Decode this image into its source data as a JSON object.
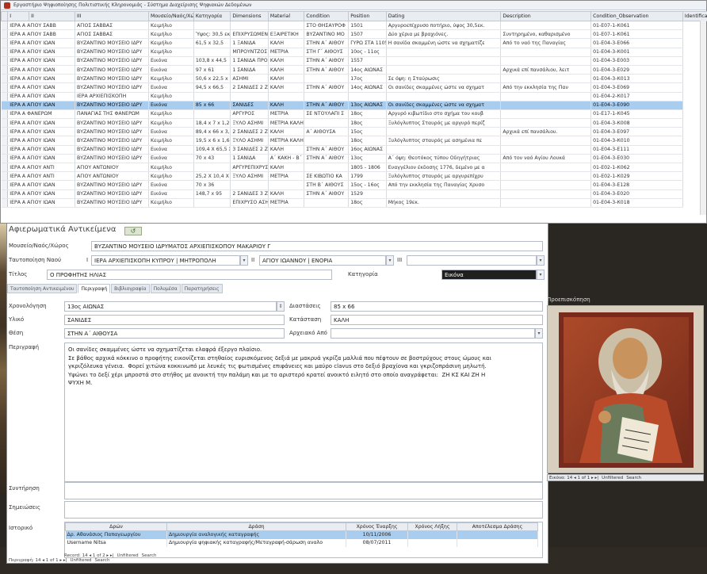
{
  "window": {
    "title": "Εργαστήριο Ψηφιοποίησης Πολιτιστικής Κληρονομιάς - Σύστημα Διαχείρισης Ψηφιακών Δεδομένων"
  },
  "grid": {
    "columns": [
      "Ι",
      "ΙΙ",
      "ΙΙΙ",
      "Μουσείο/Ναός/Χώρος",
      "Κατηγορία",
      "Dimensions",
      "Material",
      "Condition",
      "Position",
      "Dating",
      "Description",
      "Condition_Observation",
      "Identification_Number"
    ],
    "rows": [
      [
        "ΙΕΡΑ Α ΑΓΙΟΥ ΣΑΒΒ",
        "ΑΓΙΟΣ ΣΑΒΒΑΣ",
        "Κειμήλιο",
        "",
        "",
        "",
        "ΣΤΟ ΘΗΣΑΥΡΟΦ",
        "1501",
        "Αργυροεπίχρυσο ποτήριο, ύψος 30,5εκ.",
        "",
        "01-Ε07-1-К061"
      ],
      [
        "ΙΕΡΑ Α ΑΓΙΟΥ ΣΑΒΒ",
        "ΑΓΙΟΣ ΣΑΒΒΑΣ",
        "Κειμήλιο",
        "Ύψος: 30,5 εκ.,",
        "ΕΠΙΧΡΥΣΩΜΕΝ",
        "ΕΞΑΙΡΕΤΙΚΗ",
        "ΒΥΖΑΝΤΙΝΟ ΜΟ",
        "1507",
        "Δύο χέρια με βραχιόνες.",
        "Συντηρημένο, καθαρισμένο",
        "01-Ε07-1-К061"
      ],
      [
        "ΙΕΡΑ Α ΑΓΙΟΥ ΙΩΑΝ",
        "ΒΥΖΑΝΤΙΝΟ ΜΟΥΣΕΙΟ ΙΔΡΥ",
        "Κειμήλιο",
        "61,5 x 32,5",
        "1 ΞΑΝΙΔΑ",
        "ΚΑΛΗ",
        "ΣΤΗΝ Α΄ ΑΙΘΟΥ",
        "ΓΥΡΩ ΣΤΑ 1105",
        "Η σανίδα σκαμμένη ώστε να σχηματίζε",
        "Από το ναό της Παναγίας",
        "01-Ε04-3-Е066"
      ],
      [
        "ΙΕΡΑ Α ΑΓΙΟΥ ΙΩΑΝ",
        "ΒΥΖΑΝΤΙΝΟ ΜΟΥΣΕΙΟ ΙΔΡΥ",
        "Κειμήλιο",
        "",
        "ΜΠΡΟΥΝΤΖΟΣ",
        "ΜΕΤΡΙΑ",
        "ΣΤΗ Γ΄ ΑΙΘΟΥΣ",
        "10ος - 11ος",
        "",
        "",
        "01-Ε04-3-К001"
      ],
      [
        "ΙΕΡΑ Α ΑΓΙΟΥ ΙΩΑΝ",
        "ΒΥΖΑΝΤΙΝΟ ΜΟΥΣΕΙΟ ΙΔΡΥ",
        "Εικόνα",
        "103,8 x 44,5",
        "1 ΣΑΝΙΔΑ ΠΡΟΣ",
        "ΚΑΛΗ",
        "ΣΤΗΝ Α΄ ΑΙΘΟΥ",
        "1557",
        "",
        "",
        "01-Ε04-3-Е003"
      ],
      [
        "ΙΕΡΑ Α ΑΓΙΟΥ ΙΩΑΝ",
        "ΒΥΖΑΝΤΙΝΟ ΜΟΥΣΕΙΟ ΙΔΡΥ",
        "Εικόνα",
        "97 x 61",
        "1 ΣΑΝΙΔΑ",
        "ΚΑΛΗ",
        "ΣΤΗΝ Α΄ ΑΙΘΟΥ",
        "14ος ΑΙΩΝΑΣ",
        "",
        "Αρχικά επί πανσάλιου, λειτ",
        "01-Ε04-3-Е029"
      ],
      [
        "ΙΕΡΑ Α ΑΓΙΟΥ ΙΩΑΝ",
        "ΒΥΖΑΝΤΙΝΟ ΜΟΥΣΕΙΟ ΙΔΡΥ",
        "Κειμήλιο",
        "50,6 x 22,5 x 2,",
        "ΑΣΗΜΙ",
        "ΚΑΛΗ",
        "",
        "17ος",
        "Σε όψη: η Σταύρωσις",
        "",
        "01-Ε04-3-К013"
      ],
      [
        "ΙΕΡΑ Α ΑΓΙΟΥ ΙΩΑΝ",
        "ΒΥΖΑΝΤΙΝΟ ΜΟΥΣΕΙΟ ΙΔΡΥ",
        "Εικόνα",
        "94,5 x 66,5",
        "2 ΣΑΝΙΔΕΣ 2 ΖΥΓ",
        "ΚΑΛΗ",
        "ΣΤΗΝ Α΄ ΑΙΘΟΥ",
        "14ος ΑΙΩΝΑΣ",
        "Οι σανίδες σκαμμένες ώστε να σχηματ",
        "Από την εκκλησία της Παν",
        "01-Ε04-3-Е069"
      ],
      [
        "ΙΕΡΑ Α ΑΓΙΟΥ ΙΩΑΝ",
        "ΙΕΡΑ ΑΡΧΙΕΠΙΣΚΟΠΗ",
        "Κειμήλιο",
        "",
        "",
        "",
        "",
        "",
        "",
        "",
        "01-Ε04-2-К017"
      ],
      [
        "ΙΕΡΑ Α ΑΓΙΟΥ ΙΩΑΝ",
        "ΒΥΖΑΝΤΙΝΟ ΜΟΥΣΕΙΟ ΙΔΡΥ",
        "Εικόνα",
        "85 x 66",
        "ΣΑΝΙΔΕΣ",
        "ΚΑΛΗ",
        "ΣΤΗΝ Α΄ ΑΙΘΟΥ",
        "13ος ΑΙΩΝΑΣ",
        "Οι σανίδες σκαμμένες ώστε να σχηματ",
        "",
        "01-Ε04-3-Е090"
      ],
      [
        "ΙΕΡΑ Α ΦΑΝΕΡΩΜ",
        "ΠΑΝΑΓΙΑΣ ΤΗΣ ΦΑΝΕΡΩΜ",
        "Κειμήλιο",
        "",
        "ΑΡΓΥΡΟΣ",
        "ΜΕΤΡΙΑ",
        "ΣΕ ΝΤΟΥΛΑΠΙ Σ",
        "18ος",
        "Αργυρό κιβωτίδιο στο σχήμα του κουβ",
        "",
        "01-Ε17-1-К045"
      ],
      [
        "ΙΕΡΑ Α ΑΓΙΟΥ ΙΩΑΝ",
        "ΒΥΖΑΝΤΙΝΟ ΜΟΥΣΕΙΟ ΙΔΡΥ",
        "Κειμήλιο",
        "18,4 x 7 x 1,2",
        "ΞΥΛΟ ΑΣΗΜΙ",
        "ΜΕΤΡΙΑ ΚΑΛΗ",
        "",
        "18ος",
        "Ξυλόγλυπτος Σταυρός με αργυρό περίζ",
        "",
        "01-Ε04-3-К008"
      ],
      [
        "ΙΕΡΑ Α ΑΓΙΟΥ ΙΩΑΝ",
        "ΒΥΖΑΝΤΙΝΟ ΜΟΥΣΕΙΟ ΙΔΡΥ",
        "Εικόνα",
        "89,4 x 66 x 3,4",
        "2 ΣΑΝΙΔΕΣ 2 ΖΥΓ",
        "ΚΑΛΗ",
        "Α΄ ΑΙΘΟΥΣΑ",
        "15ος",
        "",
        "Αρχικά επί πανσάλιου.",
        "01-Ε04-3-Е097"
      ],
      [
        "ΙΕΡΑ Α ΑΓΙΟΥ ΙΩΑΝ",
        "ΒΥΖΑΝΤΙΝΟ ΜΟΥΣΕΙΟ ΙΔΡΥ",
        "Κειμήλιο",
        "19,5 x 6 x 1,6",
        "ΞΥΛΟ ΑΣΗΜΙ",
        "ΜΕΤΡΙΑ ΚΑΛΗ",
        "",
        "18ος",
        "Ξυλόγλυπτος σταυρός με ασημένια πε",
        "",
        "01-Ε04-3-К010"
      ],
      [
        "ΙΕΡΑ Α ΑΓΙΟΥ ΙΩΑΝ",
        "ΒΥΖΑΝΤΙΝΟ ΜΟΥΣΕΙΟ ΙΔΡΥ",
        "Εικόνα",
        "109,4 X 65,5 X 3,",
        "3 ΣΑΝΙΔΕΣ 2 ΖΥΓ",
        "ΚΑΛΗ",
        "ΣΤΗΝ Α΄ ΑΙΘΟΥ",
        "16ος ΑΙΩΝΑΣ",
        "",
        "",
        "01-Ε04-3-Е111"
      ],
      [
        "ΙΕΡΑ Α ΑΓΙΟΥ ΙΩΑΝ",
        "ΒΥΖΑΝΤΙΝΟ ΜΟΥΣΕΙΟ ΙΔΡΥ",
        "Εικόνα",
        "70 x 43",
        "1 ΣΑΝΙΔΑ",
        "Α΄ ΚΑΚΗ - Β΄ ΚΑ",
        "ΣΤΗΝ Α΄ ΑΙΘΟΥ",
        "13ος",
        "Α΄ όψη: Θεοτόκος τύπου Οδηγήτριας",
        "Από τον ναό Αγίου Λουκά",
        "01-Ε04-3-Е030"
      ],
      [
        "ΙΕΡΑ Α ΑΓΙΟΥ ΑΝΤΙ",
        "ΑΓΙΟΥ ΑΝΤΩΝΙΟΥ",
        "Κειμήλιο",
        "",
        "ΑΡΓΥΡΕΠΙΧΡΥΣ",
        "ΚΑΛΗ",
        "",
        "1805 - 1806",
        "Ευαγγέλιον έκδοσης 1776, δεμένο με α",
        "",
        "01-Ε02-1-К062"
      ],
      [
        "ΙΕΡΑ Α ΑΓΙΟΥ ΑΝΤΙ",
        "ΑΓΙΟΥ ΑΝΤΩΝΙΟΥ",
        "Κειμήλιο",
        "25,2 X 10,4 X 2,",
        "ΞΥΛΟ ΑΣΗΜΙ",
        "ΜΕΤΡΙΑ",
        "ΣΕ ΚΙΒΩΤΙΟ ΚΑ",
        "1799",
        "Ξυλόγλυπτος σταυρός με αργυρεπίχρυ",
        "",
        "01-Ε02-1-К029"
      ],
      [
        "ΙΕΡΑ Α ΑΓΙΟΥ ΙΩΑΝ",
        "ΒΥΖΑΝΤΙΝΟ ΜΟΥΣΕΙΟ ΙΔΡΥ",
        "Εικόνα",
        "70 x 36",
        "",
        "",
        "ΣΤΗ Β΄ ΑΙΘΟΥΣ",
        "15ος - 16ος",
        "Από την εκκλησία της Παναγίας Χρυσο",
        "",
        "01-Ε04-3-Е128"
      ],
      [
        "ΙΕΡΑ Α ΑΓΙΟΥ ΙΩΑΝ",
        "ΒΥΖΑΝΤΙΝΟ ΜΟΥΣΕΙΟ ΙΔΡΥ",
        "Εικόνα",
        "148,7 x 95",
        "2 ΣΑΝΙΔΕΣ 3 ΖΥΓ",
        "ΚΑΛΗ",
        "ΣΤΗΝ Α΄ ΑΙΘΟΥ",
        "1529",
        "",
        "",
        "01-Ε04-3-Е020"
      ],
      [
        "ΙΕΡΑ Α ΑΓΙΟΥ ΙΩΑΝ",
        "ΒΥΖΑΝΤΙΝΟ ΜΟΥΣΕΙΟ ΙΔΡΥ",
        "Κειμήλιο",
        "",
        "ΕΠΙΧΡΥΣΟ ΑΣΗΜΙ",
        "ΜΕΤΡΙΑ",
        "",
        "18ος",
        "Μήκος 19εκ.",
        "",
        "01-Ε04-3-К018"
      ]
    ],
    "selected_row_index": 9
  },
  "form": {
    "title": "Αφιερωματικά Αντικείμενα",
    "record_button": "↺",
    "fields": {
      "museum_label": "Μουσείο/Ναός/Χώρος",
      "museum_value": "ΒΥΖΑΝΤΙΝΟ ΜΟΥΣΕΙΟ ΙΔΡΥΜΑΤΟΣ ΑΡΧΙΕΠΙΣΚΟΠΟΥ ΜΑΚΑΡΙΟΥ Γ",
      "church_label": "Ταυτοποίηση Ναού",
      "church_i_label": "Ι",
      "church_i_value": "ΙΕΡΑ ΑΡΧΙΕΠΙΣΚΟΠΗ ΚΥΠΡΟΥ | ΜΗΤΡΟΠΟΛΗ",
      "church_ii_label": "ΙΙ",
      "church_ii_value": "ΑΓΙΟΥ ΙΩΑΝΝΟΥ | ΕΝΟΡΙΑ",
      "church_iii_label": "ΙΙΙ",
      "church_iii_value": "",
      "title_label": "Τίτλος",
      "title_value": "Ο ΠΡΟΦΗΤΗΣ ΗΛΙΑΣ",
      "category_label": "Κατηγορία",
      "category_value": "Εικόνα",
      "dating_label": "Χρονολόγηση",
      "dating_value": "13ος ΑΙΩΝΑΣ",
      "dimensions_label": "Διαστάσεις",
      "dimensions_value": "85 x 66",
      "material_label": "Υλικό",
      "material_value": "ΣΑΝΙΔΕΣ",
      "condition_label": "Κατάσταση",
      "condition_value": "ΚΑΛΗ",
      "position_label": "Θέση",
      "position_value": "ΣΤΗΝ Α΄ ΑΙΘΟΥΣΑ",
      "archive_label": "Αρχειακό Από",
      "archive_value": "",
      "description_label": "Περιγραφή",
      "description_value": "Οι σανίδες σκαμμένες ώστε να σχηματίζεται ελαφρά έξεργο πλαίσιο.\nΣε βάθος αρχικά κόκκινο ο προφήτης εικονίζεται στηθαίος ευρισκόμενος δεξιά με μακρυά γκρίζα μαλλιά που πέφτουν σε βοστρύχους στους ώμους και\nγκριζόλευκα γένεια.  Φορεί χιτώνα κοκκινωπό με λευκές τις φωτισμένες επιφάνειες και μαύρο clavus στο δεξιό βραχίονα και γκριζοπράσινη μηλωτή.\nΥψώνει το δεξί χέρι μπροστά στο στήθος με ανοικτή την παλάμη και με το αριστερό κρατεί ανοικτό ειλητό στο οποίο αναγράφεται:  ΖΗ ΚΣ ΚΑΙ ΖΗ Η\nΨΥΧΗ Μ.",
      "conservation_label": "Συντήρηση",
      "notes_label": "Σημειώσεις",
      "history_label": "Ιστορικό"
    },
    "tabs": [
      "Ταυτοποίηση Αντικειμένου",
      "Περιγραφή",
      "Βιβλιογραφία",
      "Πολυμέσα",
      "Παρατηρήσεις"
    ],
    "active_tab": 1,
    "history": {
      "columns": [
        "Δρών",
        "Δράση",
        "Χρόνος Έναρξης",
        "Χρόνος Λήξης",
        "Αποτέλεσμα Δράσης"
      ],
      "rows": [
        [
          "Δρ. Αθανάσιος Παπαγεωργίου",
          "Δημιουργία αναλογικής καταγραφής",
          "10/11/2006",
          "",
          ""
        ],
        [
          "Username Nitsa",
          "Δημιουργία ψηφιακής καταγραφής/Μεταγραφή-σάρωση αναλο",
          "08/07/2011",
          "",
          ""
        ]
      ],
      "nav": {
        "record": "Record: 14 ◂ 1 of 2 ▸ ▸| ",
        "filter": "Unfiltered",
        "search": "Search"
      }
    },
    "nav": {
      "record": "Περιγραφή: 14 ◂ 1 of 1 ▸ ▸| ",
      "filter": "Unfiltered",
      "search": "Search"
    }
  },
  "preview": {
    "label": "Προεπισκόπηση",
    "nav": {
      "record": "Εικόνα: 14 ◂ 1 of 1 ▸ ▸| ",
      "filter": "Unfiltered",
      "search": "Search"
    }
  }
}
